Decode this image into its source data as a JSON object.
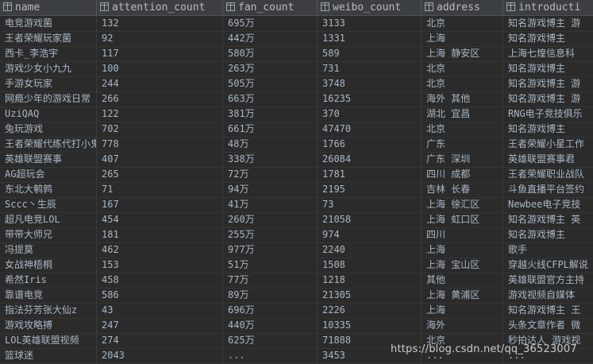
{
  "columns": [
    "name",
    "attention_count",
    "fan_count",
    "weibo_count",
    "address",
    "introducti"
  ],
  "rows": [
    [
      "电竞游戏菌",
      "132",
      "695万",
      "3133",
      "北京",
      "知名游戏博主 游"
    ],
    [
      "王者荣耀玩家菌",
      "92",
      "442万",
      "1331",
      "上海",
      "知名游戏博主"
    ],
    [
      "西卡_李浩宇",
      "117",
      "580万",
      "589",
      "上海 静安区",
      "上海七煌信息科"
    ],
    [
      "游戏少女小九九",
      "100",
      "263万",
      "731",
      "北京",
      "知名游戏博主"
    ],
    [
      "手游女玩家",
      "244",
      "505万",
      "3748",
      "北京",
      "知名游戏博主 游"
    ],
    [
      "网瘾少年的游戏日常",
      "266",
      "663万",
      "16235",
      "海外 其他",
      "知名游戏博主 游"
    ],
    [
      "UziQAQ",
      "122",
      "381万",
      "370",
      "湖北 宜昌",
      "RNG电子竞技俱乐"
    ],
    [
      "兔玩游戏",
      "702",
      "661万",
      "47470",
      "北京",
      "知名游戏博主"
    ],
    [
      "王者荣耀代练代打小鬼",
      "778",
      "48万",
      "1766",
      "广东",
      "王者荣耀小星工作"
    ],
    [
      "英雄联盟赛事",
      "407",
      "338万",
      "26084",
      "广东 深圳",
      "英雄联盟赛事君"
    ],
    [
      "AG超玩会",
      "265",
      "72万",
      "1781",
      "四川 成都",
      "王者荣耀职业战队"
    ],
    [
      "东北大鹌鹑",
      "71",
      "94万",
      "2195",
      "吉林 长春",
      "斗鱼直播平台签约"
    ],
    [
      "Sccc丶生辰",
      "167",
      "41万",
      "73",
      "上海 徐汇区",
      "Newbee电子竞技"
    ],
    [
      "超凡电竞LOL",
      "454",
      "260万",
      "21058",
      "上海 虹口区",
      "知名游戏博主 英"
    ],
    [
      "带带大师兄",
      "181",
      "255万",
      "974",
      "四川",
      "知名游戏博主"
    ],
    [
      "冯提莫",
      "462",
      "977万",
      "2240",
      "上海",
      "歌手"
    ],
    [
      "女战神梧桐",
      "153",
      "51万",
      "1508",
      "上海 宝山区",
      "穿越火线CFPL解说"
    ],
    [
      "希然Iris",
      "458",
      "77万",
      "1218",
      "其他",
      "英雄联盟官方主持"
    ],
    [
      "靠谱电竞",
      "586",
      "89万",
      "21305",
      "上海 黄浦区",
      "游戏视频自媒体"
    ],
    [
      "指法芬芳张大仙z",
      "43",
      "696万",
      "2226",
      "上海",
      "知名游戏博主 王"
    ],
    [
      "游戏攻略搏",
      "247",
      "440万",
      "10335",
      "海外",
      "头条文章作者 微"
    ],
    [
      "LOL英雄联盟视频",
      "274",
      "625万",
      "71888",
      "北京",
      "秒拍达人 游戏视"
    ],
    [
      "篮球迷",
      "2043",
      "...",
      "3453",
      "...",
      "..."
    ]
  ],
  "watermark": "https://blog.csdn.net/qq_36523007"
}
